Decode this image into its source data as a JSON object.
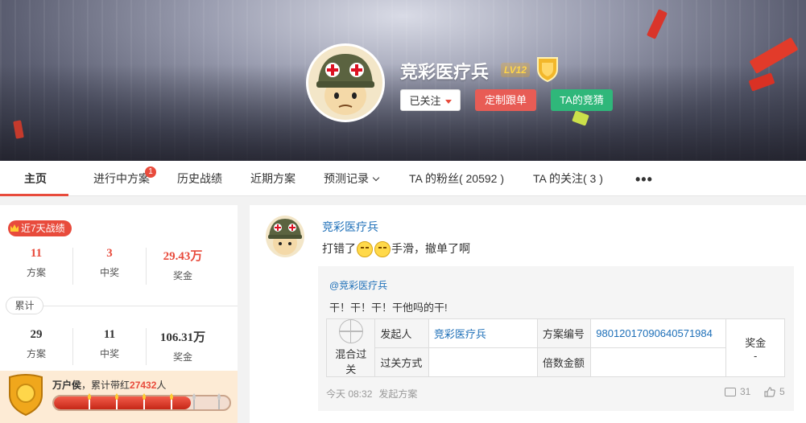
{
  "header": {
    "username": "竞彩医疗兵",
    "level": "LV12",
    "follow_label": "已关注",
    "custom_label": "定制跟单",
    "ta_label": "TA的竞猜"
  },
  "nav": {
    "items": [
      "主页",
      "进行中方案",
      "历史战绩",
      "近期方案",
      "预测记录",
      "TA 的粉丝( 20592 )",
      "TA 的关注( 3 )"
    ],
    "badge": "1",
    "more": "•••"
  },
  "stats": {
    "week_label": "近7天战绩",
    "week": [
      {
        "value": "11",
        "label": "方案"
      },
      {
        "value": "3",
        "label": "中奖"
      },
      {
        "value": "29.43万",
        "label": "奖金"
      }
    ],
    "total_label": "累计",
    "total": [
      {
        "value": "29",
        "label": "方案"
      },
      {
        "value": "11",
        "label": "中奖"
      },
      {
        "value": "106.31万",
        "label": "奖金"
      }
    ]
  },
  "honor": {
    "title": "万户侯",
    "text_prefix": "，累计带红",
    "count": "27432",
    "text_suffix": "人",
    "progress": 0.78
  },
  "post": {
    "author": "竞彩医疗兵",
    "text_before": "打错了",
    "text_after": "手滑，撤单了啊",
    "quote_author": "@竞彩医疗兵",
    "quote_text": "干！干！干！干他吗的干!",
    "plan": {
      "type": "混合过关",
      "initiator_label": "发起人",
      "initiator": "竞彩医疗兵",
      "plan_no_label": "方案编号",
      "plan_no": "98012017090640571984",
      "pass_label": "过关方式",
      "multiple_label": "倍数金额",
      "prize_label": "奖金",
      "prize_value": "-"
    },
    "time": "今天 08:32",
    "action": "发起方案",
    "comments": "31",
    "likes": "5"
  },
  "colors": {
    "accent": "#e84b3c",
    "green": "#2fb77a",
    "link": "#1d6fb8"
  }
}
